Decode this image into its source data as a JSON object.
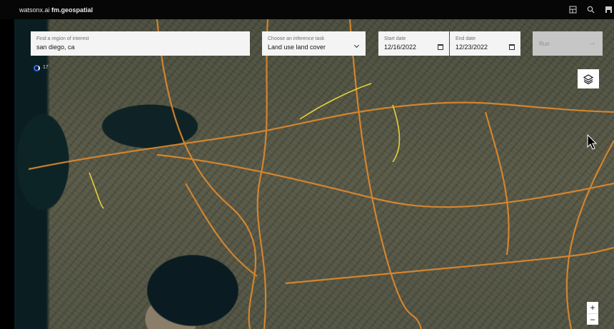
{
  "header": {
    "brand_prefix": "watsonx.ai",
    "brand_product": "fm.geospatial"
  },
  "header_icons": [
    "dashboard-icon",
    "search-icon",
    "save-icon"
  ],
  "controls": {
    "region": {
      "label": "Find a region of interest",
      "value": "san diego, ca"
    },
    "task": {
      "label": "Choose an inference task",
      "value": "Land use land cover"
    },
    "start_date": {
      "label": "Start date",
      "value": "12/16/2022"
    },
    "end_date": {
      "label": "End date",
      "value": "12/23/2022"
    },
    "run_label": "Run"
  },
  "map": {
    "loading_count": "17",
    "zoom_in": "+",
    "zoom_out": "−"
  },
  "colors": {
    "road": "#e08a2c",
    "highway_yellow": "#e6d23a",
    "spinner": "#3a6cf0"
  }
}
